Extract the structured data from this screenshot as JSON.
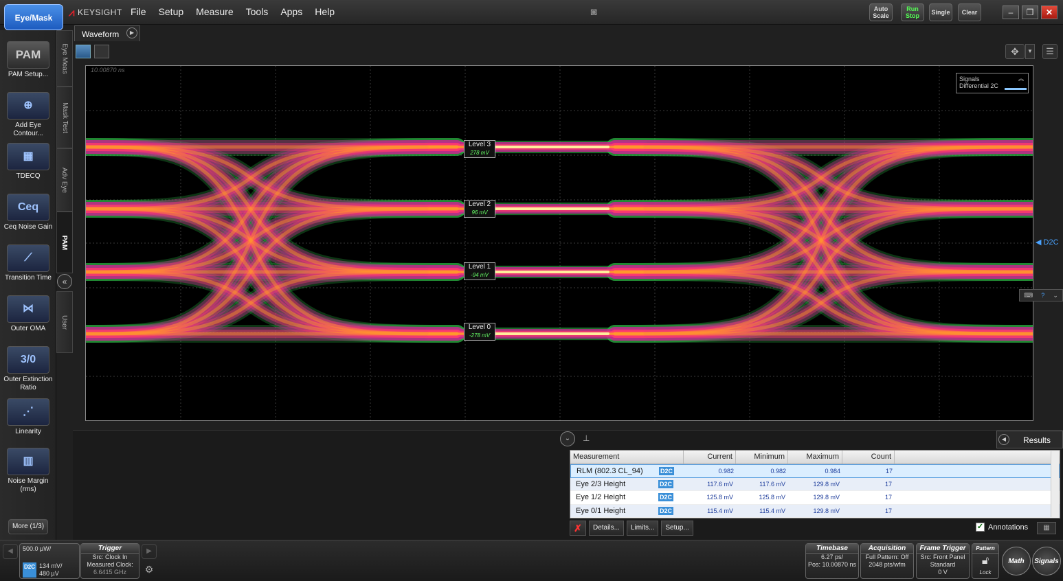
{
  "app": {
    "mode_button": "Eye/Mask",
    "brand": "KEYSIGHT",
    "menus": [
      "File",
      "Setup",
      "Measure",
      "Tools",
      "Apps",
      "Help"
    ],
    "toolbar_buttons": {
      "autoscale": "Auto Scale",
      "runstop": "Run Stop",
      "single": "Single",
      "clear": "Clear"
    }
  },
  "left_tools": [
    {
      "label": "PAM Setup...",
      "icon": "pam-icon",
      "glyph": "PAM"
    },
    {
      "label": "Add Eye Contour...",
      "icon": "add-eye-contour-icon",
      "glyph": "⊕"
    },
    {
      "label": "TDECQ",
      "icon": "tdecq-icon",
      "glyph": "▦"
    },
    {
      "label": "Ceq Noise Gain",
      "icon": "ceq-icon",
      "glyph": "Ceq"
    },
    {
      "label": "Transition Time",
      "icon": "transition-time-icon",
      "glyph": "⟋"
    },
    {
      "label": "Outer OMA",
      "icon": "outer-oma-icon",
      "glyph": "⋈"
    },
    {
      "label": "Outer Extinction Ratio",
      "icon": "outer-extinction-ratio-icon",
      "glyph": "3/0"
    },
    {
      "label": "Linearity",
      "icon": "linearity-icon",
      "glyph": "⋰"
    },
    {
      "label": "Noise Margin (rms)",
      "icon": "noise-margin-icon",
      "glyph": "▥"
    }
  ],
  "more_button": "More (1/3)",
  "vertical_tabs": [
    "Eye Meas",
    "Mask Test",
    "Adv Eye",
    "PAM",
    "User"
  ],
  "waveform": {
    "tab_label": "Waveform",
    "time_readout": "10.00870 ns",
    "legend_title": "Signals",
    "legend_signal": "Differential 2C",
    "channel_marker": "D2C",
    "levels": [
      {
        "label": "Level 3",
        "value": "278 mV"
      },
      {
        "label": "Level 2",
        "value": "96 mV"
      },
      {
        "label": "Level 1",
        "value": "-94 mV"
      },
      {
        "label": "Level 0",
        "value": "-278 mV"
      }
    ]
  },
  "results": {
    "tab_label": "Results",
    "headers": [
      "Measurement",
      "Current",
      "Minimum",
      "Maximum",
      "Count"
    ],
    "rows": [
      {
        "name": "RLM (802.3 CL_94)",
        "src": "D2C",
        "current": "0.982",
        "minimum": "0.982",
        "maximum": "0.984",
        "count": "17"
      },
      {
        "name": "Eye 2/3 Height",
        "src": "D2C",
        "current": "117.6 mV",
        "minimum": "117.6 mV",
        "maximum": "129.8 mV",
        "count": "17"
      },
      {
        "name": "Eye 1/2 Height",
        "src": "D2C",
        "current": "125.8 mV",
        "minimum": "125.8 mV",
        "maximum": "129.8 mV",
        "count": "17"
      },
      {
        "name": "Eye 0/1 Height",
        "src": "D2C",
        "current": "115.4 mV",
        "minimum": "115.4 mV",
        "maximum": "129.8 mV",
        "count": "17"
      }
    ],
    "actions": [
      "Details...",
      "Limits...",
      "Setup..."
    ],
    "annotations_label": "Annotations"
  },
  "status": {
    "scale": "500.0 µW/",
    "channel": "D2C",
    "ch_line1": "134 mV/",
    "ch_line2": "480 µV",
    "trigger_title": "Trigger",
    "trigger_line1": "Src: Clock In",
    "trigger_line2": "Measured Clock:",
    "trigger_line3": "6.6415 GHz",
    "timebase_title": "Timebase",
    "timebase_line1": "6.27 ps/",
    "timebase_line2": "Pos: 10.00870 ns",
    "acq_title": "Acquisition",
    "acq_line1": "Full Pattern: Off",
    "acq_line2": "2048 pts/wfm",
    "frame_title": "Frame Trigger",
    "frame_line1": "Src: Front Panel",
    "frame_line2": "Standard",
    "frame_line3": "0 V",
    "pattern_title": "Pattern",
    "pattern_lock": "Lock",
    "math": "Math",
    "signals": "Signals"
  }
}
